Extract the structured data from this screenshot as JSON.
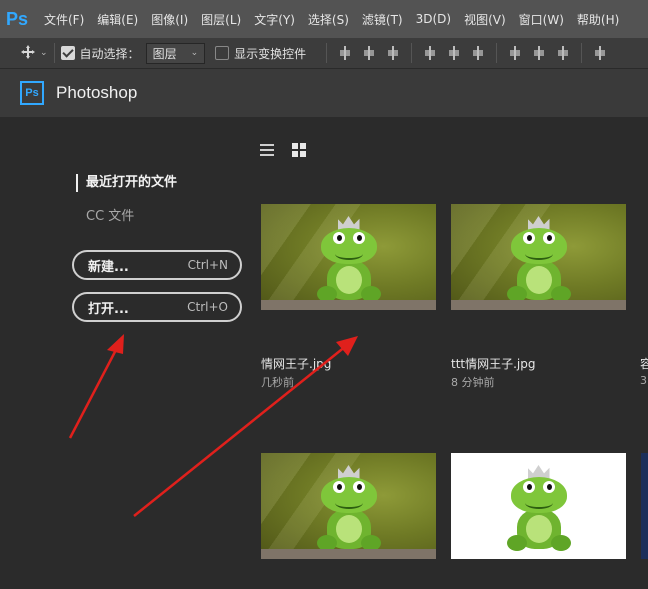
{
  "menubar": {
    "logo": "Ps",
    "items": [
      "文件(F)",
      "编辑(E)",
      "图像(I)",
      "图层(L)",
      "文字(Y)",
      "选择(S)",
      "滤镜(T)",
      "3D(D)",
      "视图(V)",
      "窗口(W)",
      "帮助(H)"
    ]
  },
  "options": {
    "auto_select_label": "自动选择：",
    "auto_select_checked": true,
    "layer_select_value": "图层",
    "show_transform_label": "显示变换控件",
    "show_transform_checked": false
  },
  "titlebar": {
    "badge": "Ps",
    "app_name": "Photoshop"
  },
  "sidebar": {
    "recent_label": "最近打开的文件",
    "cc_label": "CC 文件",
    "new_button": {
      "label": "新建...",
      "shortcut": "Ctrl+N"
    },
    "open_button": {
      "label": "打开...",
      "shortcut": "Ctrl+O"
    }
  },
  "files": [
    {
      "name": "情网王子.jpg",
      "time": "几秒前"
    },
    {
      "name": "ttt情网王子.jpg",
      "time": "8 分钟前"
    },
    {
      "name": "容",
      "time": "3"
    }
  ],
  "colors": {
    "accent": "#31a8ff",
    "annotation_arrow": "#e0201c"
  }
}
